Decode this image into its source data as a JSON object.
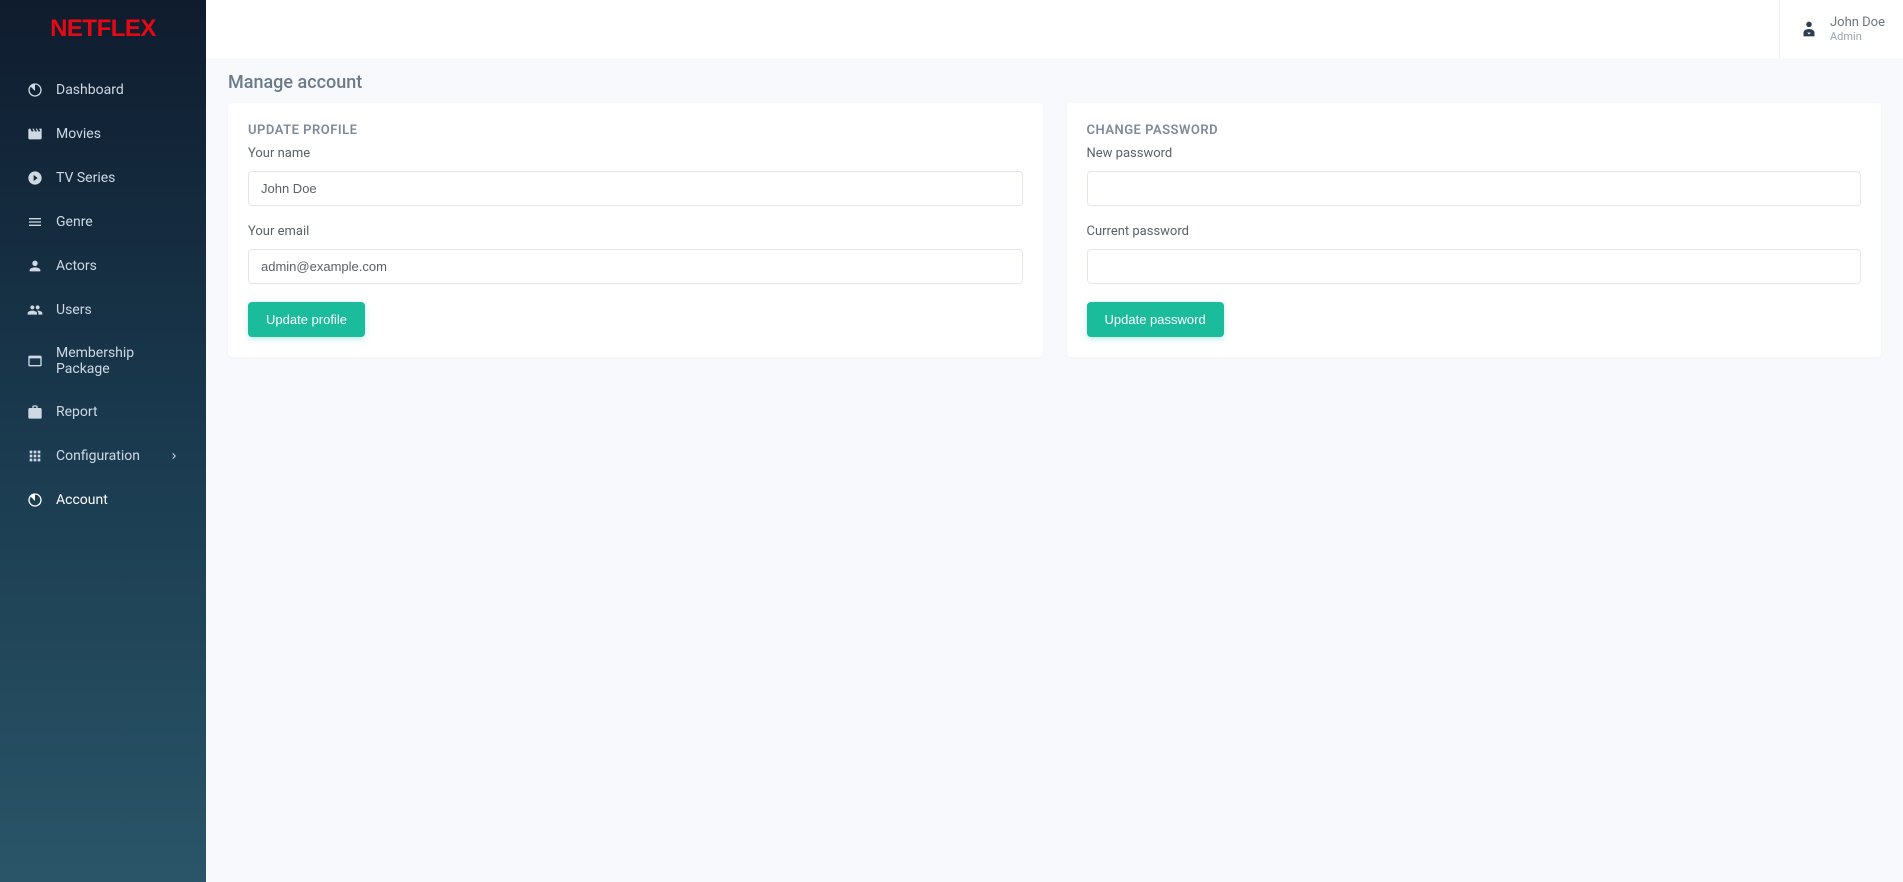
{
  "brand": "NETFLEX",
  "header": {
    "user_name": "John Doe",
    "user_role": "Admin"
  },
  "sidebar": {
    "items": [
      {
        "label": "Dashboard",
        "icon": "dashboard-icon",
        "active": false
      },
      {
        "label": "Movies",
        "icon": "movie-icon",
        "active": false
      },
      {
        "label": "TV Series",
        "icon": "tv-icon",
        "active": false
      },
      {
        "label": "Genre",
        "icon": "list-icon",
        "active": false
      },
      {
        "label": "Actors",
        "icon": "person-icon",
        "active": false
      },
      {
        "label": "Users",
        "icon": "people-icon",
        "active": false
      },
      {
        "label": "Membership Package",
        "icon": "membership-icon",
        "active": false
      },
      {
        "label": "Report",
        "icon": "report-icon",
        "active": false
      },
      {
        "label": "Configuration",
        "icon": "grid-icon",
        "active": false,
        "has_children": true
      },
      {
        "label": "Account",
        "icon": "account-icon",
        "active": true
      }
    ]
  },
  "page": {
    "title": "Manage account"
  },
  "profile_card": {
    "title": "UPDATE PROFILE",
    "name_label": "Your name",
    "name_value": "John Doe",
    "email_label": "Your email",
    "email_value": "admin@example.com",
    "button": "Update profile"
  },
  "password_card": {
    "title": "CHANGE PASSWORD",
    "new_password_label": "New password",
    "new_password_value": "",
    "current_password_label": "Current password",
    "current_password_value": "",
    "button": "Update password"
  }
}
